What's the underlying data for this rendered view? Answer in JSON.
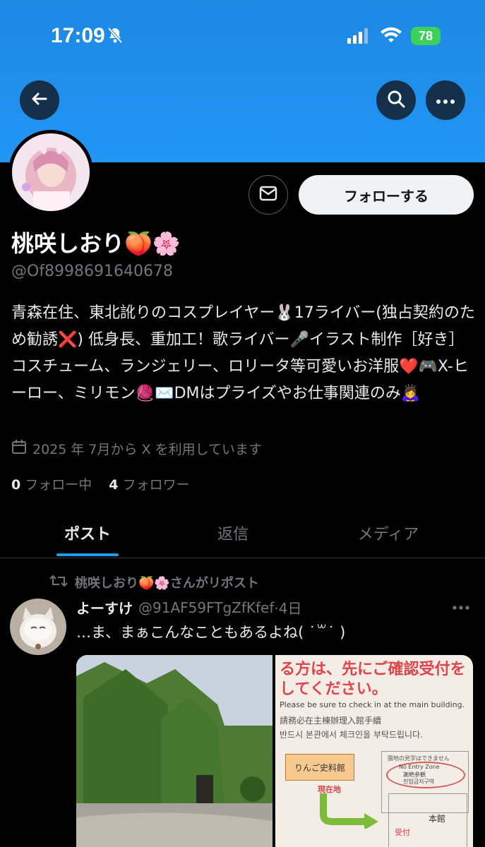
{
  "status_bar": {
    "time": "17:09",
    "battery": "78"
  },
  "profile": {
    "name": "桃咲しおり🍑🌸",
    "handle": "@Of8998691640678",
    "bio": "青森在住、東北訛りのコスプレイヤー🐰17ライバー(独占契約のため勧誘❌) 低身長、重加工！歌ライバー🎤イラスト制作［好き］コスチューム、ランジェリー、ロリータ等可愛いお洋服❤️🎮X-ヒーロー、ミリモン🧶✉️DMはプライズやお仕事関連のみ🙇‍♀️",
    "joined": "2025 年 7月から X を利用しています",
    "following_count": "0",
    "following_label": "フォロー中",
    "followers_count": "4",
    "followers_label": "フォロワー",
    "follow_button": "フォローする"
  },
  "tabs": [
    {
      "label": "ポスト",
      "active": true
    },
    {
      "label": "返信",
      "active": false
    },
    {
      "label": "メディア",
      "active": false
    }
  ],
  "post": {
    "repost_label": "桃咲しおり🍑🌸さんがリポスト",
    "author_name": "よーすけ",
    "author_handle": "@91AF59FTgZfKfef",
    "time": "·4日",
    "text": "…ま、まぁこんなこともあるよね( ˙꒳˙ )",
    "notice": {
      "line_ja": "る方は、先にご確認受付を",
      "line_ja2": "してください。",
      "line_en": "Please be sure to check in at the main building.",
      "line_zh": "請務必在主棟辦理入館手續",
      "line_ko": "반드시 본관에서 체크인을 부탁드립니다.",
      "room_label": "りんご史料館",
      "no_entry_ja": "園地の見学はできません",
      "no_entry_en": "No Entry Zone",
      "no_entry_zh": "謝絶参観",
      "no_entry_ko": "진입금지구역",
      "current_label": "現在地",
      "main_label": "本館",
      "reception_label": "受付"
    }
  },
  "colors": {
    "banner": "#1e88e5",
    "accent": "#1d9bf0",
    "battery": "#3ad05a"
  }
}
